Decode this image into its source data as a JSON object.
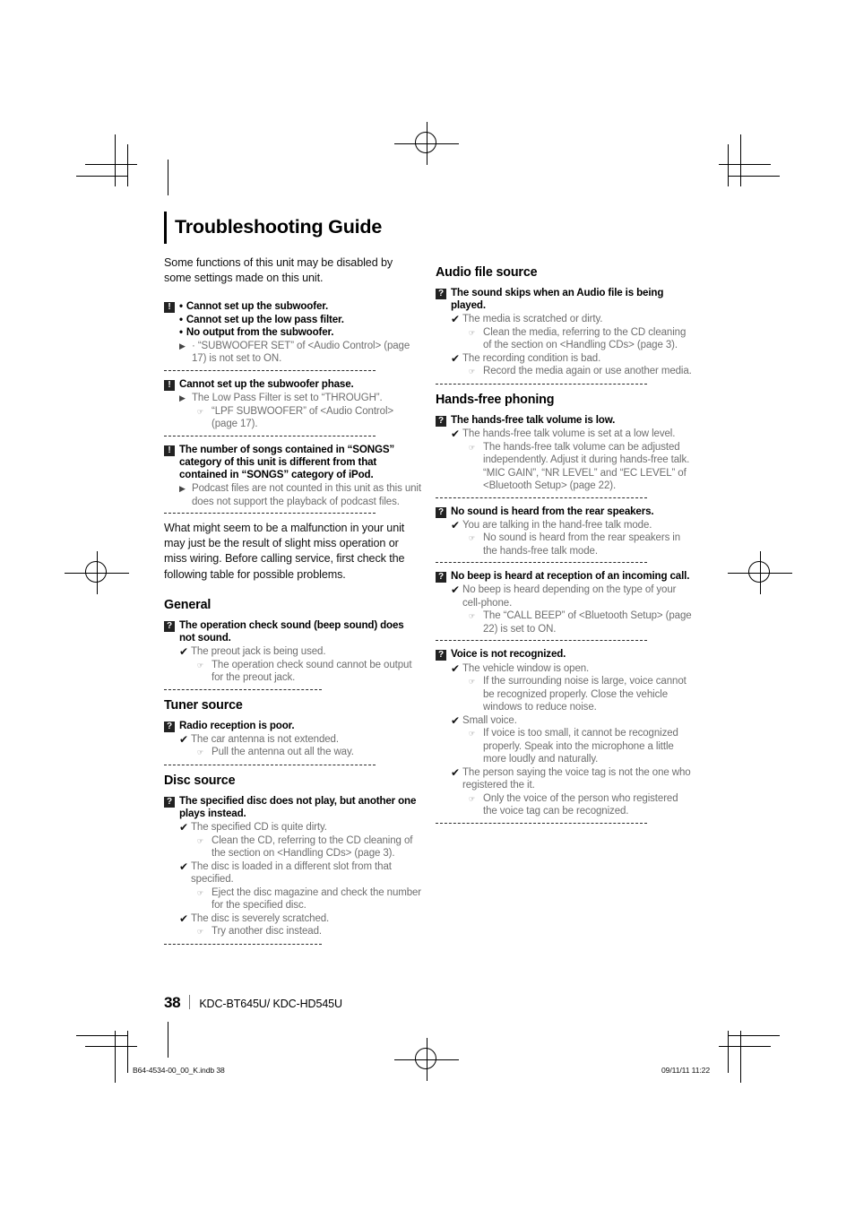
{
  "document": {
    "title": "Troubleshooting Guide",
    "intro_1": "Some functions of this unit may be disabled by some settings made on this unit.",
    "intro_2": "What might seem to be a malfunction in your unit may just be the result of slight miss operation or miss wiring. Before calling service, first check the following table for possible problems.",
    "page_number": "38",
    "models": "KDC-BT645U/ KDC-HD545U",
    "print_file": "B64-4534-00_00_K.indb  38",
    "print_timestamp": "09/11/11  11:22",
    "badge_notice": "!",
    "badge_question": "?",
    "arrow_glyph": "▶",
    "check_glyph": "✔",
    "hand_glyph": "☞"
  },
  "left_column": {
    "notices": [
      {
        "bullets": [
          "Cannot set up the subwoofer.",
          "Cannot set up the low pass filter.",
          "No output from the subwoofer."
        ],
        "answers": [
          "· “SUBWOOFER SET” of <Audio Control> (page 17) is not set to ON."
        ]
      },
      {
        "heading": "Cannot set up the subwoofer phase.",
        "answers": [
          "The Low Pass Filter is set to “THROUGH”."
        ],
        "solutions": [
          "“LPF SUBWOOFER” of <Audio Control> (page 17)."
        ]
      },
      {
        "heading": "The number of songs contained in “SONGS” category of this unit is different from that contained in “SONGS” category of iPod.",
        "answers": [
          "Podcast files are not counted in this unit as this unit does not support the playback of podcast files."
        ]
      }
    ],
    "sections": [
      {
        "heading": "General",
        "entries": [
          {
            "question": "The operation check sound (beep sound) does not sound.",
            "causes": [
              {
                "cause": "The preout jack is being used.",
                "solutions": [
                  "The operation check sound cannot be output for the preout jack."
                ]
              }
            ]
          }
        ]
      },
      {
        "heading": "Tuner source",
        "entries": [
          {
            "question": "Radio reception is poor.",
            "causes": [
              {
                "cause": "The car antenna is not extended.",
                "solutions": [
                  "Pull the antenna out all the way."
                ]
              }
            ]
          }
        ]
      },
      {
        "heading": "Disc source",
        "entries": [
          {
            "question": "The specified disc does not play, but another one plays instead.",
            "causes": [
              {
                "cause": "The specified CD is quite dirty.",
                "solutions": [
                  "Clean the CD, referring to the CD cleaning of the section on <Handling CDs> (page 3)."
                ]
              },
              {
                "cause": "The disc is loaded in a different slot from that specified.",
                "solutions": [
                  "Eject the disc magazine and check the number for the specified disc."
                ]
              },
              {
                "cause": "The disc is severely scratched.",
                "solutions": [
                  "Try another disc instead."
                ]
              }
            ]
          }
        ]
      }
    ]
  },
  "right_column": {
    "sections": [
      {
        "heading": "Audio file source",
        "entries": [
          {
            "question": "The sound skips when an Audio file is being played.",
            "causes": [
              {
                "cause": "The media is scratched or dirty.",
                "solutions": [
                  "Clean the media, referring to the CD cleaning of the section on <Handling CDs> (page 3)."
                ]
              },
              {
                "cause": "The recording condition is bad.",
                "solutions": [
                  "Record the media again or use another media."
                ]
              }
            ]
          }
        ]
      },
      {
        "heading": "Hands-free phoning",
        "entries": [
          {
            "question": "The hands-free talk volume is low.",
            "causes": [
              {
                "cause": "The hands-free talk volume is set at a low level.",
                "solutions": [
                  "The hands-free talk volume can be adjusted independently. Adjust it during hands-free talk.  “MIC GAIN”, “NR LEVEL” and “EC LEVEL” of <Bluetooth Setup> (page 22)."
                ]
              }
            ]
          },
          {
            "question": "No sound is heard from the rear speakers.",
            "causes": [
              {
                "cause": "You are talking in the hand-free talk mode.",
                "solutions": [
                  "No sound is heard from the rear speakers in the hands-free talk mode."
                ]
              }
            ]
          },
          {
            "question": "No beep is heard at reception of an incoming call.",
            "causes": [
              {
                "cause": "No beep is heard depending on the type of your cell-phone.",
                "solutions": [
                  "The “CALL BEEP” of <Bluetooth Setup> (page 22) is set to ON."
                ]
              }
            ]
          },
          {
            "question": "Voice is not recognized.",
            "causes": [
              {
                "cause": "The vehicle window is open.",
                "solutions": [
                  "If the surrounding noise is large, voice cannot be recognized properly. Close the vehicle windows to reduce noise."
                ]
              },
              {
                "cause": "Small voice.",
                "solutions": [
                  "If voice is too small, it cannot be recognized properly. Speak into the microphone a little more loudly and naturally."
                ]
              },
              {
                "cause": "The person saying the voice tag is not the one who registered the it.",
                "solutions": [
                  "Only the voice of the person who registered the voice tag can be recognized."
                ]
              }
            ]
          }
        ]
      }
    ]
  }
}
